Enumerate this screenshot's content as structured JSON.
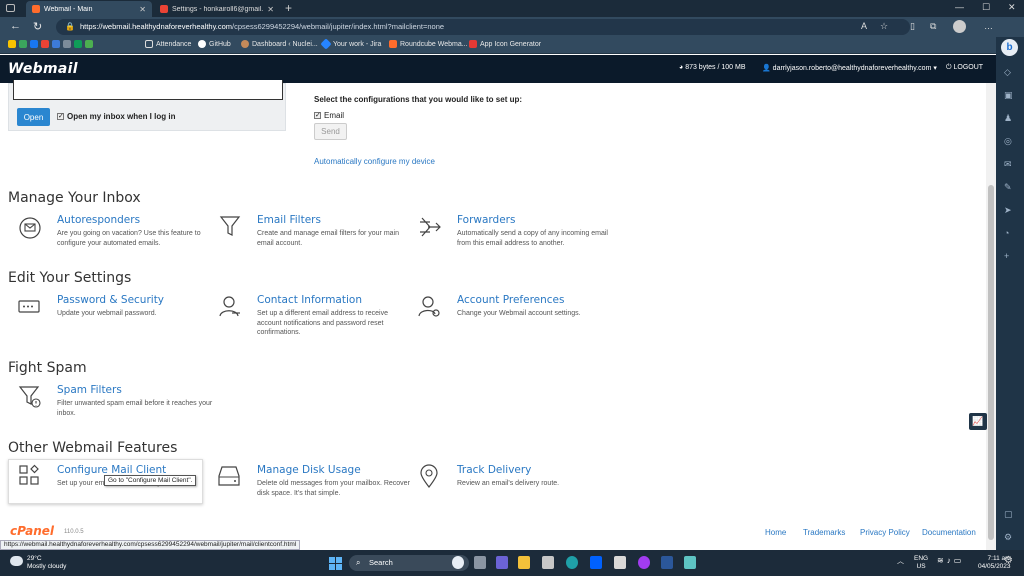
{
  "browser": {
    "tabs": [
      {
        "label": "Webmail - Main",
        "favicon_color": "#ff6c2c"
      },
      {
        "label": "Settings - honkairoll6@gmail.co",
        "favicon_color": "#ea4335"
      }
    ],
    "url_host": "https://webmail.healthydnaforeverhealthy.com",
    "url_path": "/cpsess6299452294/webmail/jupiter/index.html?mailclient=none",
    "bookmarks": [
      {
        "label": "Attendance",
        "color": "#e8e8e8"
      },
      {
        "label": "GitHub",
        "color": "#ffffff"
      },
      {
        "label": "Dashboard ‹ Nuclei...",
        "color": "#c48a5a"
      },
      {
        "label": "Your work - Jira",
        "color": "#2684ff"
      },
      {
        "label": "Roundcube Webma...",
        "color": "#ff6c2c"
      },
      {
        "label": "App Icon Generator",
        "color": "#e53935"
      }
    ]
  },
  "header": {
    "logo": "Webmail",
    "quota": "873 bytes / 100 MB",
    "user": "darrlyjason.roberto@healthydnaforeverhealthy.com",
    "logout": "LOGOUT"
  },
  "top": {
    "open_button": "Open",
    "open_inbox_label": "Open my inbox when I log in",
    "config_title": "Select the configurations that you would like to set up:",
    "email_label": "Email",
    "send_button": "Send",
    "auto_config_link": "Automatically configure my device"
  },
  "sections": {
    "manage": {
      "title": "Manage Your Inbox",
      "autoresponders": {
        "title": "Autoresponders",
        "desc": "Are you going on vacation? Use this feature to configure your automated emails."
      },
      "email_filters": {
        "title": "Email Filters",
        "desc": "Create and manage email filters for your main email account."
      },
      "forwarders": {
        "title": "Forwarders",
        "desc": "Automatically send a copy of any incoming email from this email address to another."
      }
    },
    "settings": {
      "title": "Edit Your Settings",
      "password": {
        "title": "Password & Security",
        "desc": "Update your webmail password."
      },
      "contact": {
        "title": "Contact Information",
        "desc": "Set up a different email address to receive account notifications and password reset confirmations."
      },
      "preferences": {
        "title": "Account Preferences",
        "desc": "Change your Webmail account settings."
      }
    },
    "spam": {
      "title": "Fight Spam",
      "filters": {
        "title": "Spam Filters",
        "desc": "Filter unwanted spam email before it reaches your inbox."
      }
    },
    "other": {
      "title": "Other Webmail Features",
      "configure": {
        "title": "Configure Mail Client",
        "desc": "Set up your email account on any device."
      },
      "disk": {
        "title": "Manage Disk Usage",
        "desc": "Delete old messages from your mailbox. Recover disk space. It's that simple."
      },
      "tracking": {
        "title": "Track Delivery",
        "desc": "Review an email's delivery route."
      }
    }
  },
  "tooltip": "Go to \"Configure Mail Client\".",
  "footer": {
    "logo": "cPanel",
    "version": "110.0.5",
    "links": [
      "Home",
      "Trademarks",
      "Privacy Policy",
      "Documentation"
    ]
  },
  "status_url": "https://webmail.healthydnaforeverhealthy.com/cpsess6299452294/webmail/jupiter/mail/clientconf.html",
  "taskbar": {
    "temp": "29°C",
    "weather": "Mostly cloudy",
    "search": "Search",
    "lang1": "ENG",
    "lang2": "US",
    "time": "7:11 am",
    "date": "04/05/2023"
  },
  "colors": {
    "link": "#2a78c3",
    "accent": "#2a86d0",
    "header_bg": "#0b1a2a",
    "cpanel": "#ff6c2c"
  }
}
